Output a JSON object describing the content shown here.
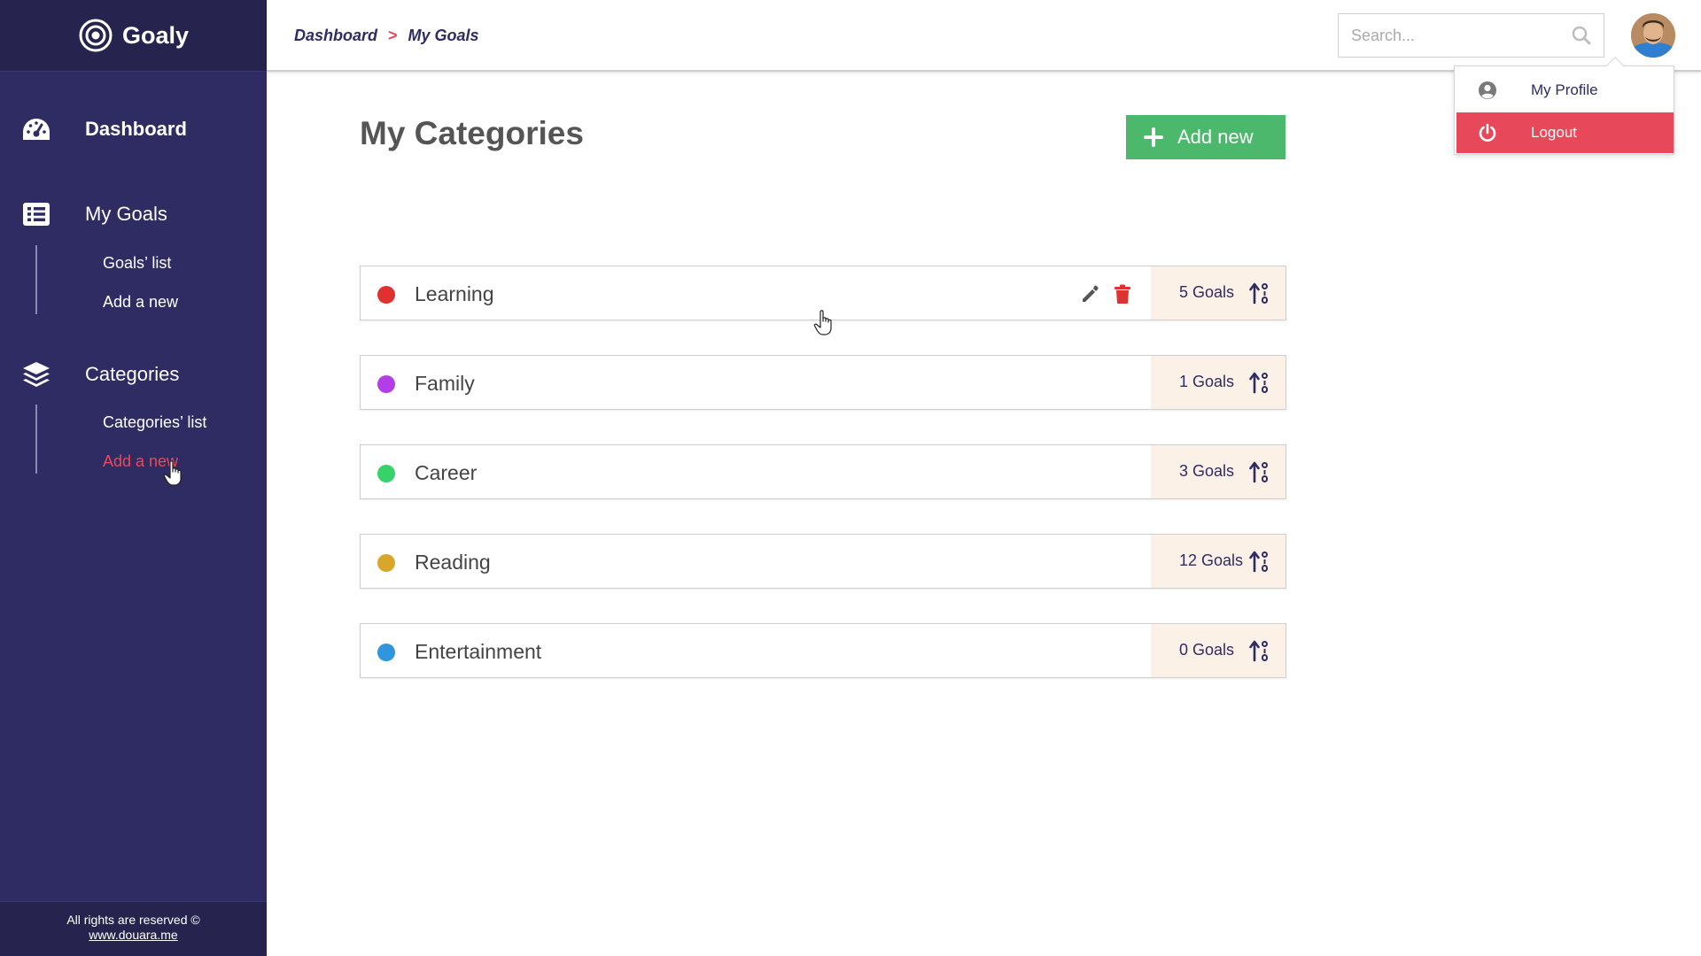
{
  "app": {
    "brand": "Goaly",
    "footer_text": "All rights are reserved ©",
    "footer_link": "www.douara.me"
  },
  "sidebar": {
    "dashboard": {
      "label": "Dashboard",
      "icon": "speedometer-icon"
    },
    "goals": {
      "label": "My Goals",
      "icon": "list-icon",
      "items": [
        {
          "label": "Goals’ list"
        },
        {
          "label": "Add a new"
        }
      ]
    },
    "categories": {
      "label": "Categories",
      "icon": "layers-icon",
      "items": [
        {
          "label": "Categories’ list"
        },
        {
          "label": "Add a new",
          "active": true
        }
      ]
    }
  },
  "header": {
    "breadcrumb": [
      "Dashboard",
      "My Goals"
    ],
    "breadcrumb_sep": ">",
    "search_placeholder": "Search..."
  },
  "profile_menu": {
    "items": [
      {
        "label": "My Profile",
        "icon": "user-circle-icon"
      },
      {
        "label": "Logout",
        "icon": "power-icon"
      }
    ]
  },
  "main": {
    "title": "My Categories",
    "add_label": "Add new",
    "categories": [
      {
        "name": "Learning",
        "count": "5 Goals",
        "color": "#e03131",
        "hovered": true
      },
      {
        "name": "Family",
        "count": "1 Goals",
        "color": "#b43ee6"
      },
      {
        "name": "Career",
        "count": "3 Goals",
        "color": "#38d26b"
      },
      {
        "name": "Reading",
        "count": "12 Goals",
        "color": "#d8a72a"
      },
      {
        "name": "Entertainment",
        "count": "0 Goals",
        "color": "#2f95dc"
      }
    ]
  },
  "colors": {
    "sidebar": "#2e2c63",
    "accent_red": "#e8495a",
    "add_green": "#4cb86c",
    "count_bg": "#fcf1e6"
  }
}
